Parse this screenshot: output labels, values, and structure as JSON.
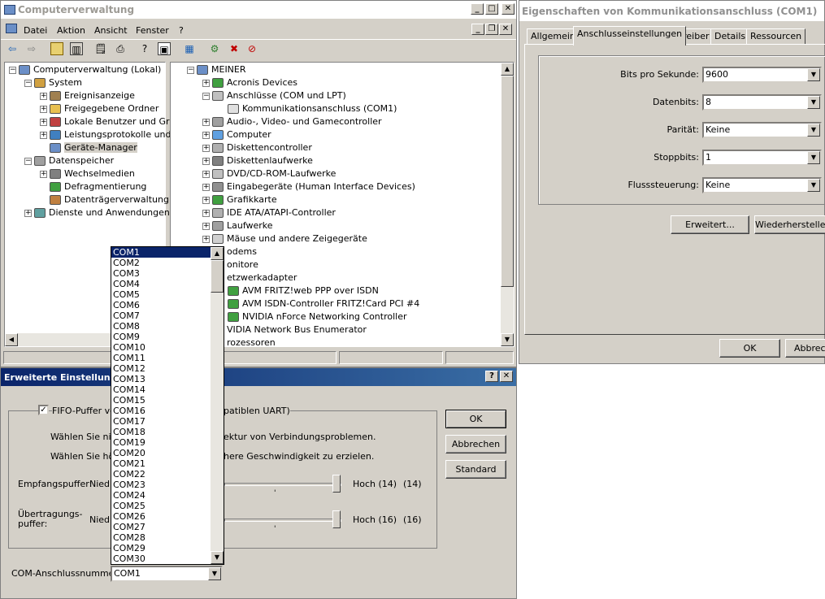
{
  "mmc": {
    "title": "Computerverwaltung",
    "menu": [
      "Datei",
      "Aktion",
      "Ansicht",
      "Fenster",
      "?"
    ],
    "left_tree": [
      {
        "label": "Computerverwaltung (Lokal)",
        "level": 0,
        "exp": "−"
      },
      {
        "label": "System",
        "level": 1,
        "exp": "−"
      },
      {
        "label": "Ereignisanzeige",
        "level": 2,
        "exp": "+"
      },
      {
        "label": "Freigegebene Ordner",
        "level": 2,
        "exp": "+"
      },
      {
        "label": "Lokale Benutzer und Gruppe",
        "level": 2,
        "exp": "+"
      },
      {
        "label": "Leistungsprotokolle und War",
        "level": 2,
        "exp": "+"
      },
      {
        "label": "Geräte-Manager",
        "level": 2,
        "exp": ""
      },
      {
        "label": "Datenspeicher",
        "level": 1,
        "exp": "−"
      },
      {
        "label": "Wechselmedien",
        "level": 2,
        "exp": "+"
      },
      {
        "label": "Defragmentierung",
        "level": 2,
        "exp": ""
      },
      {
        "label": "Datenträgerverwaltung",
        "level": 2,
        "exp": ""
      },
      {
        "label": "Dienste und Anwendungen",
        "level": 1,
        "exp": "+"
      }
    ],
    "right_tree": [
      {
        "label": "MEINER",
        "level": 0,
        "exp": "−"
      },
      {
        "label": "Acronis Devices",
        "level": 1,
        "exp": "+"
      },
      {
        "label": "Anschlüsse (COM und LPT)",
        "level": 1,
        "exp": "−"
      },
      {
        "label": "Kommunikationsanschluss (COM1)",
        "level": 2,
        "exp": ""
      },
      {
        "label": "Audio-, Video- und Gamecontroller",
        "level": 1,
        "exp": "+"
      },
      {
        "label": "Computer",
        "level": 1,
        "exp": "+"
      },
      {
        "label": "Diskettencontroller",
        "level": 1,
        "exp": "+"
      },
      {
        "label": "Diskettenlaufwerke",
        "level": 1,
        "exp": "+"
      },
      {
        "label": "DVD/CD-ROM-Laufwerke",
        "level": 1,
        "exp": "+"
      },
      {
        "label": "Eingabegeräte (Human Interface Devices)",
        "level": 1,
        "exp": "+"
      },
      {
        "label": "Grafikkarte",
        "level": 1,
        "exp": "+"
      },
      {
        "label": "IDE ATA/ATAPI-Controller",
        "level": 1,
        "exp": "+"
      },
      {
        "label": "Laufwerke",
        "level": 1,
        "exp": "+"
      },
      {
        "label": "Mäuse und andere Zeigegeräte",
        "level": 1,
        "exp": "+"
      },
      {
        "label": "odems",
        "level": 1,
        "exp": ""
      },
      {
        "label": "onitore",
        "level": 1,
        "exp": ""
      },
      {
        "label": "etzwerkadapter",
        "level": 1,
        "exp": ""
      },
      {
        "label": "AVM FRITZ!web PPP over ISDN",
        "level": 2,
        "exp": ""
      },
      {
        "label": "AVM ISDN-Controller FRITZ!Card PCI #4",
        "level": 2,
        "exp": ""
      },
      {
        "label": "NVIDIA nForce Networking Controller",
        "level": 2,
        "exp": ""
      },
      {
        "label": "VIDIA Network Bus Enumerator",
        "level": 1,
        "exp": ""
      },
      {
        "label": "rozessoren",
        "level": 1,
        "exp": ""
      }
    ]
  },
  "props": {
    "title": "Eigenschaften von Kommunikationsanschluss (COM1)",
    "tabs": [
      "Allgemein",
      "Anschlusseinstellungen",
      "Treiber",
      "Details",
      "Ressourcen"
    ],
    "active_tab": "Anschlusseinstellungen",
    "fields": [
      {
        "label": "Bits pro Sekunde:",
        "value": "9600"
      },
      {
        "label": "Datenbits:",
        "value": "8"
      },
      {
        "label": "Parität:",
        "value": "Keine"
      },
      {
        "label": "Stoppbits:",
        "value": "1"
      },
      {
        "label": "Flusssteuerung:",
        "value": "Keine"
      }
    ],
    "erweitert": "Erweitert...",
    "wiederherstellen": "Wiederherstellen",
    "ok": "OK",
    "abbrechen": "Abbrech"
  },
  "advanced": {
    "title": "Erweiterte Einstellungen",
    "fifo_label": "FIFO-Puffer ve",
    "fifo_suffix": "patiblen UART)",
    "hint1_a": "Wählen Sie nie",
    "hint1_b": "ektur von Verbindungsproblemen.",
    "hint2_a": "Wählen Sie höh",
    "hint2_b": "here Geschwindigkeit zu erzielen.",
    "empfang_label": "Empfangspuffer:",
    "empfang_low": "Niedr",
    "empfang_high": "Hoch (14)",
    "empfang_val": "(14)",
    "uebertragung_label_1": "Übertragungs-",
    "uebertragung_label_2": "puffer:",
    "uebertragung_low": "Niedr",
    "uebertragung_high": "Hoch (16)",
    "uebertragung_val": "(16)",
    "com_label": "COM-Anschlussnummer:",
    "com_value": "COM1",
    "ok": "OK",
    "abbrechen": "Abbrechen",
    "standard": "Standard",
    "com_options": [
      "COM1",
      "COM2",
      "COM3",
      "COM4",
      "COM5",
      "COM6",
      "COM7",
      "COM8",
      "COM9",
      "COM10",
      "COM11",
      "COM12",
      "COM13",
      "COM14",
      "COM15",
      "COM16",
      "COM17",
      "COM18",
      "COM19",
      "COM20",
      "COM21",
      "COM22",
      "COM23",
      "COM24",
      "COM25",
      "COM26",
      "COM27",
      "COM28",
      "COM29",
      "COM30"
    ]
  }
}
